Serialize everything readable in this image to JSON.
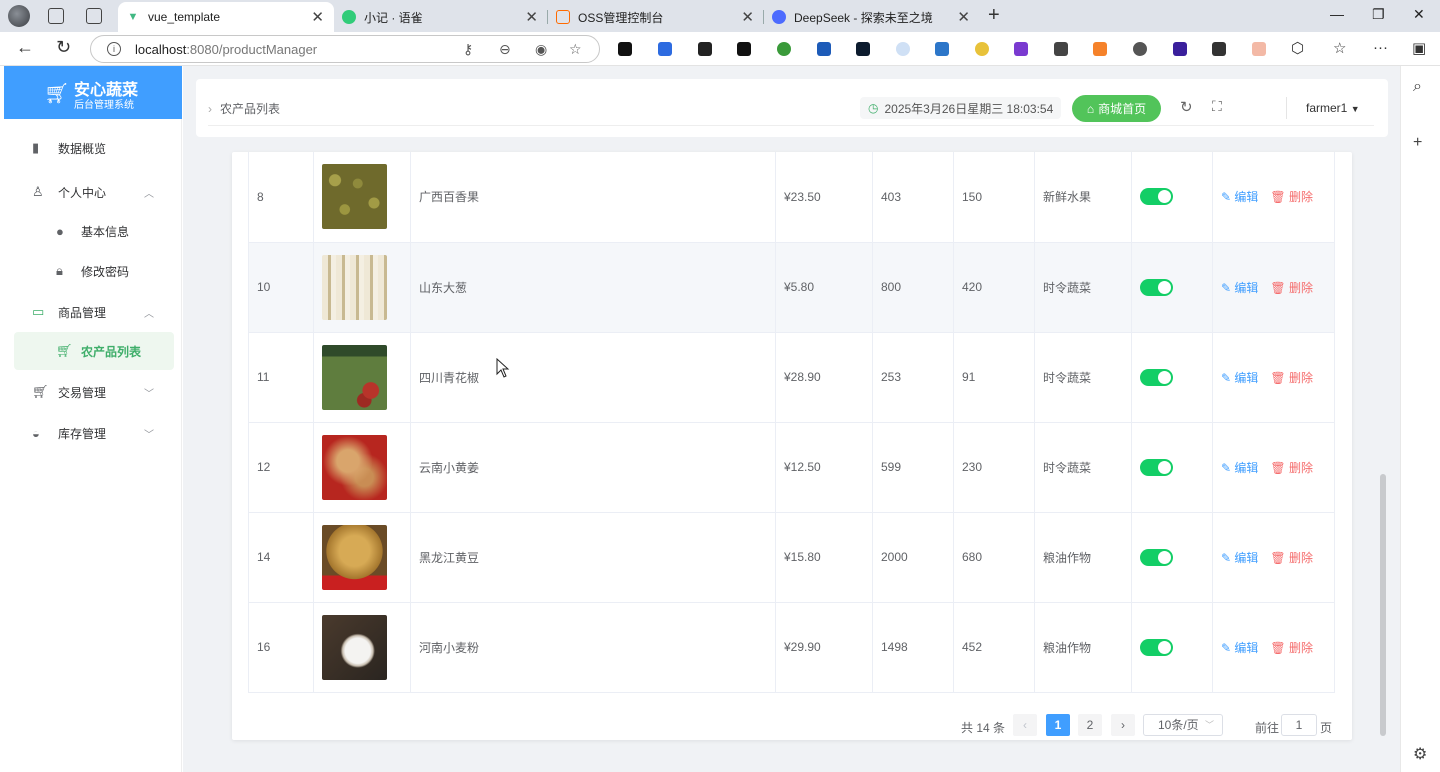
{
  "browser": {
    "tabs": [
      {
        "title": "vue_template",
        "active": true
      },
      {
        "title": "小记 · 语雀",
        "active": false
      },
      {
        "title": "OSS管理控制台",
        "active": false
      },
      {
        "title": "DeepSeek - 探索未至之境",
        "active": false
      }
    ],
    "url": "localhost:8080/productManager",
    "url_host": "localhost",
    "url_rest": ":8080/productManager"
  },
  "sidebar": {
    "app_name": "安心蔬菜",
    "app_sub": "后台管理系统",
    "items": [
      {
        "label": "数据概览",
        "icon": "bar-chart-icon"
      },
      {
        "label": "个人中心",
        "icon": "user-icon"
      },
      {
        "label": "基本信息",
        "icon": "info-icon"
      },
      {
        "label": "修改密码",
        "icon": "lock-icon"
      },
      {
        "label": "商品管理",
        "icon": "goods-icon"
      },
      {
        "label": "农产品列表",
        "icon": "cart-icon"
      },
      {
        "label": "交易管理",
        "icon": "cart-icon"
      },
      {
        "label": "库存管理",
        "icon": "bowl-icon"
      }
    ]
  },
  "header": {
    "breadcrumb": "农产品列表",
    "datetime": "2025年3月26日星期三 18:03:54",
    "shop_button": "商城首页",
    "user": "farmer1"
  },
  "table": {
    "rows": [
      {
        "id": "8",
        "name": "广西百香果",
        "price": "¥23.50",
        "stock": "403",
        "sales": "150",
        "category": "新鲜水果",
        "on": true,
        "img": "peas"
      },
      {
        "id": "10",
        "name": "山东大葱",
        "price": "¥5.80",
        "stock": "800",
        "sales": "420",
        "category": "时令蔬菜",
        "on": true,
        "img": "onion"
      },
      {
        "id": "11",
        "name": "四川青花椒",
        "price": "¥28.90",
        "stock": "253",
        "sales": "91",
        "category": "时令蔬菜",
        "on": true,
        "img": "pepper"
      },
      {
        "id": "12",
        "name": "云南小黄姜",
        "price": "¥12.50",
        "stock": "599",
        "sales": "230",
        "category": "时令蔬菜",
        "on": true,
        "img": "ginger"
      },
      {
        "id": "14",
        "name": "黑龙江黄豆",
        "price": "¥15.80",
        "stock": "2000",
        "sales": "680",
        "category": "粮油作物",
        "on": true,
        "img": "soy"
      },
      {
        "id": "16",
        "name": "河南小麦粉",
        "price": "¥29.90",
        "stock": "1498",
        "sales": "452",
        "category": "粮油作物",
        "on": true,
        "img": "flour"
      }
    ],
    "edit_label": "编辑",
    "delete_label": "删除"
  },
  "pagination": {
    "total": "共 14 条",
    "pages": [
      "1",
      "2"
    ],
    "current": "1",
    "page_size": "10条/页",
    "goto_label": "前往",
    "goto_value": "1",
    "page_suffix": "页"
  },
  "colors": {
    "accent": "#409eff",
    "green": "#52c45a",
    "switch_on": "#13ce66",
    "danger": "#f56c6c"
  }
}
